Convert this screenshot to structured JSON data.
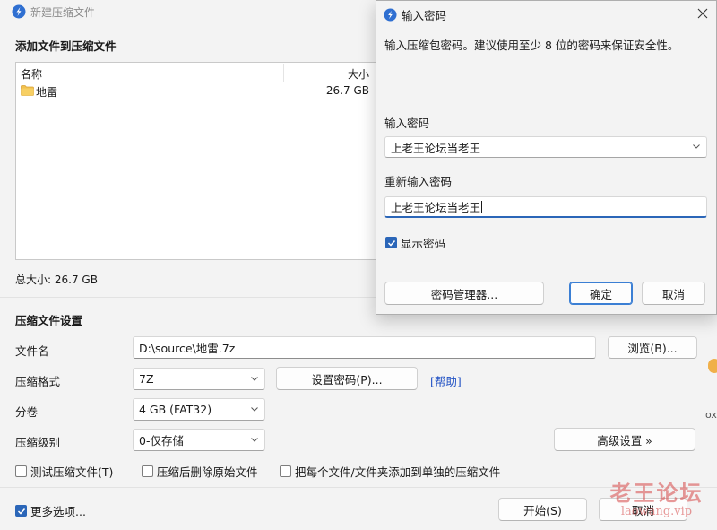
{
  "main": {
    "title": "新建压缩文件",
    "add_section_title": "添加文件到压缩文件",
    "filelist": {
      "columns": [
        "名称",
        "大小"
      ],
      "rows": [
        {
          "name": "地雷",
          "size": "26.7 GB",
          "icon": "folder-icon"
        }
      ]
    },
    "total_size": "总大小: 26.7 GB",
    "settings_title": "压缩文件设置",
    "filename_label": "文件名",
    "filename_value": "D:\\source\\地雷.7z",
    "browse_button": "浏览(B)...",
    "format_label": "压缩格式",
    "format_value": "7Z",
    "set_password_button": "设置密码(P)...",
    "help_link": "[帮助]",
    "split_label": "分卷",
    "split_value": "4 GB (FAT32)",
    "level_label": "压缩级别",
    "level_value": "0-仅存储",
    "advanced_button": "高级设置 »",
    "checkboxes": [
      {
        "label": "测试压缩文件(T)",
        "checked": false
      },
      {
        "label": "压缩后删除原始文件",
        "checked": false
      },
      {
        "label": "把每个文件/文件夹添加到单独的压缩文件",
        "checked": false
      }
    ],
    "more_options": {
      "label": "更多选项...",
      "checked": true
    },
    "start_button": "开始(S)",
    "cancel_button": "取消",
    "edge_text": "ox",
    "watermark": {
      "title": "老王论坛",
      "url": "laowang.vip"
    }
  },
  "dialog": {
    "title": "输入密码",
    "description": "输入压缩包密码。建议使用至少 8 位的密码来保证安全性。",
    "password_label": "输入密码",
    "password_value": "上老王论坛当老王",
    "confirm_label": "重新输入密码",
    "confirm_value": "上老王论坛当老王",
    "show_password": {
      "label": "显示密码",
      "checked": true
    },
    "manager_button": "密码管理器...",
    "ok_button": "确定",
    "cancel_button": "取消"
  },
  "colors": {
    "accent": "#2b66b8",
    "link": "#2252c4",
    "app_icon": "#2f6fd1",
    "folder": "#f2c14e"
  }
}
